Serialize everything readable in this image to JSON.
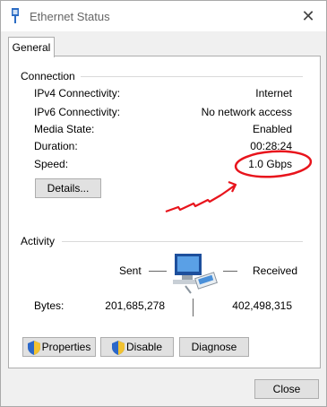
{
  "window": {
    "title": "Ethernet Status",
    "close_glyph": "✕"
  },
  "tabs": [
    {
      "label": "General"
    }
  ],
  "connection": {
    "group_label": "Connection",
    "rows": [
      {
        "label": "IPv4 Connectivity:",
        "value": "Internet"
      },
      {
        "label": "IPv6 Connectivity:",
        "value": "No network access"
      },
      {
        "label": "Media State:",
        "value": "Enabled"
      },
      {
        "label": "Duration:",
        "value": "00:28:24"
      },
      {
        "label": "Speed:",
        "value": "1.0 Gbps"
      }
    ],
    "details_button": "Details..."
  },
  "activity": {
    "group_label": "Activity",
    "sent_label": "Sent",
    "received_label": "Received",
    "bytes_label": "Bytes:",
    "bytes_sent": "201,685,278",
    "bytes_received": "402,498,315"
  },
  "buttons": {
    "properties": "Properties",
    "disable": "Disable",
    "diagnose": "Diagnose",
    "close": "Close"
  },
  "annotation_color": "#e8141c",
  "icons": [
    "ethernet-icon",
    "close-icon",
    "shield-icon",
    "network-computer-icon"
  ]
}
